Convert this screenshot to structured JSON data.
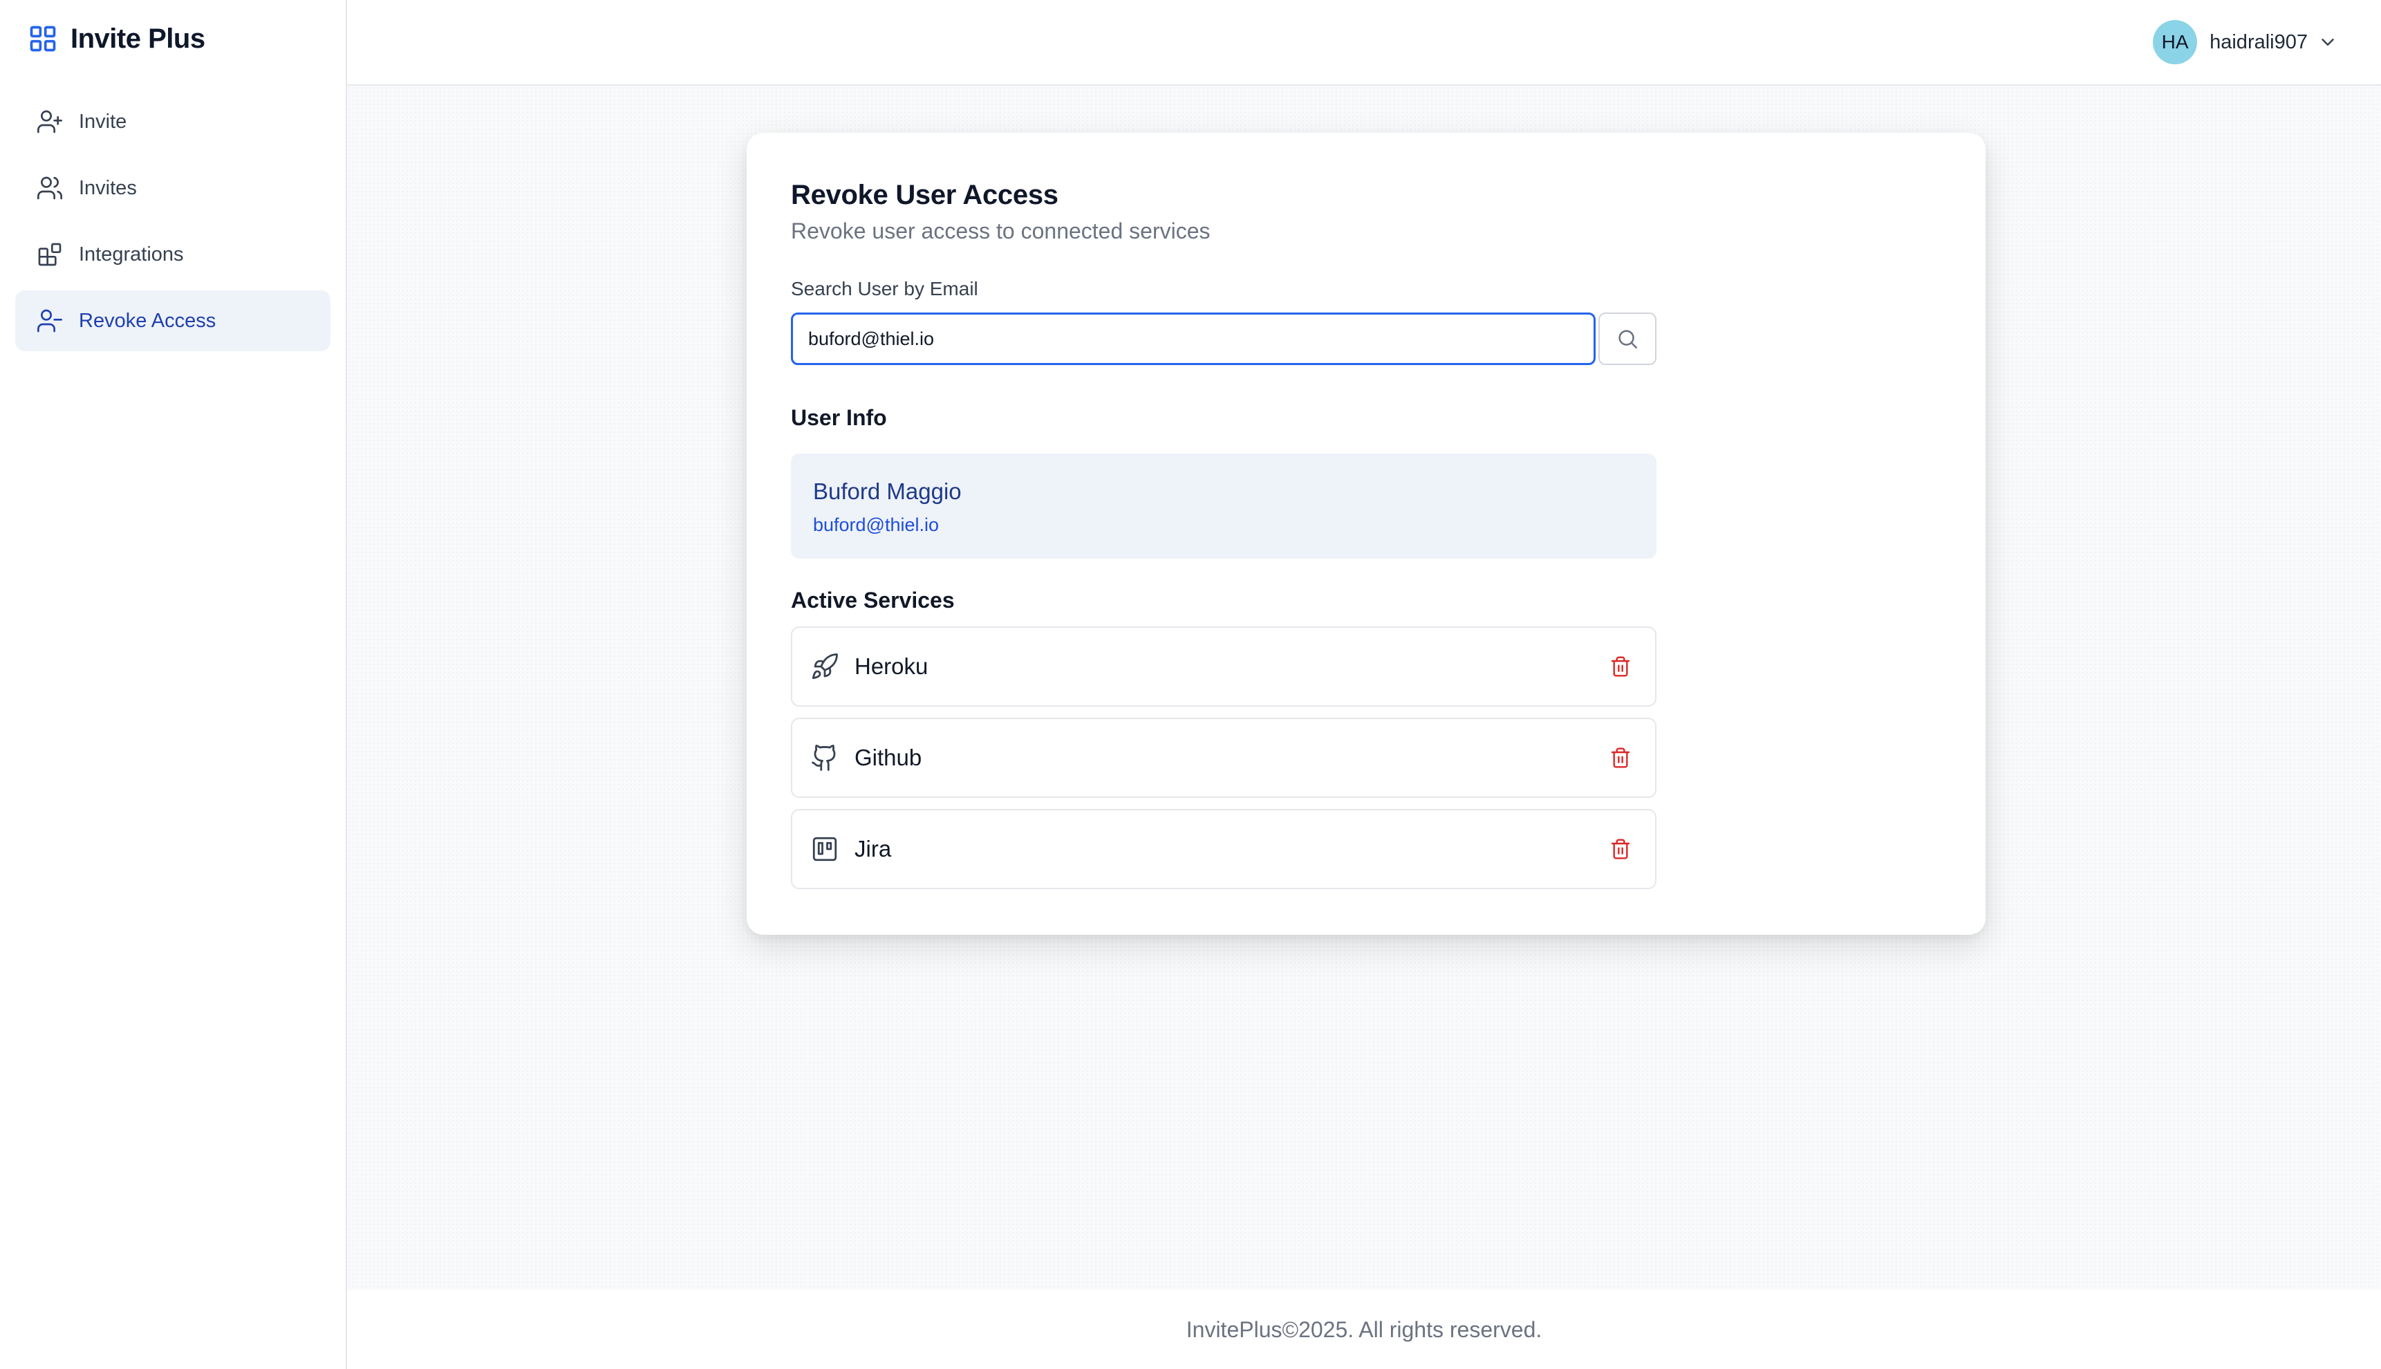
{
  "app": {
    "title": "Invite Plus"
  },
  "sidebar": {
    "items": [
      {
        "label": "Invite",
        "icon": "user-plus-icon",
        "active": false
      },
      {
        "label": "Invites",
        "icon": "users-icon",
        "active": false
      },
      {
        "label": "Integrations",
        "icon": "blocks-icon",
        "active": false
      },
      {
        "label": "Revoke Access",
        "icon": "user-minus-icon",
        "active": true
      }
    ]
  },
  "header": {
    "avatar_initials": "HA",
    "username": "haidrali907"
  },
  "card": {
    "title": "Revoke User Access",
    "subtitle": "Revoke user access to connected services",
    "search_label": "Search User by Email",
    "search_value": "buford@thiel.io",
    "user_info_title": "User Info",
    "user": {
      "name": "Buford Maggio",
      "email": "buford@thiel.io"
    },
    "services_title": "Active Services",
    "services": [
      {
        "name": "Heroku",
        "icon": "rocket-icon"
      },
      {
        "name": "Github",
        "icon": "github-icon"
      },
      {
        "name": "Jira",
        "icon": "kanban-icon"
      }
    ]
  },
  "footer": {
    "text": "InvitePlus©2025. All rights reserved."
  },
  "colors": {
    "accent": "#2563eb",
    "active_nav_bg": "#eef2f9",
    "active_nav_text": "#1e40af",
    "danger": "#dc2626",
    "avatar_bg": "#8bd3e6"
  }
}
